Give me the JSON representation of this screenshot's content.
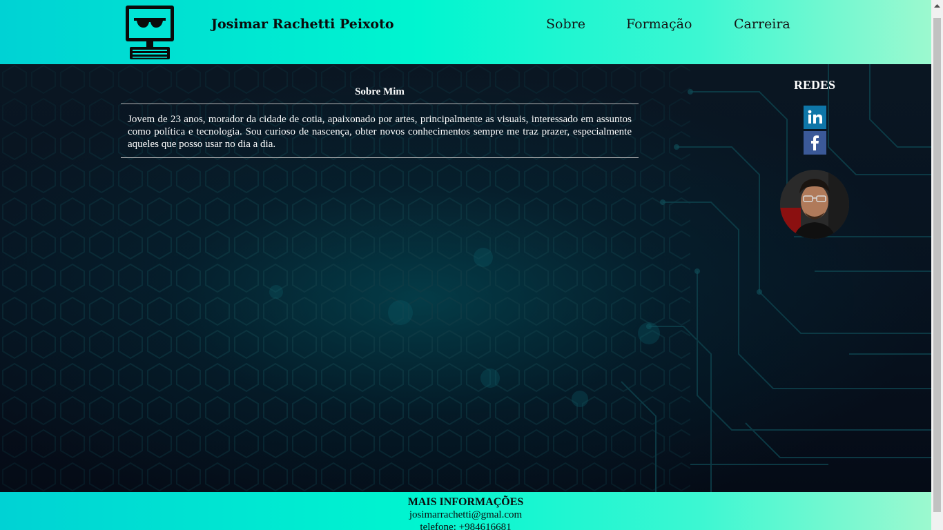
{
  "header": {
    "site_title": "Josimar Rachetti Peixoto",
    "nav": [
      {
        "label": "Sobre"
      },
      {
        "label": "Formação"
      },
      {
        "label": "Carreira"
      }
    ],
    "logo_icon": "computer-sunglasses-icon"
  },
  "about": {
    "title": "Sobre Mim",
    "text": "Jovem de 23 anos, morador da cidade de cotia, apaixonado por artes, principalmente as visuais, interessado em assuntos como política e tecnologia. Sou curioso de nascença, obter novos conhecimentos sempre me traz prazer, especialmente aqueles que posso usar no dia a dia."
  },
  "sidebar": {
    "title": "REDES",
    "social": [
      {
        "icon": "linkedin-icon",
        "color": "#0e76a8"
      },
      {
        "icon": "facebook-icon",
        "color": "#3b5998"
      }
    ],
    "avatar_icon": "profile-photo"
  },
  "footer": {
    "title": "MAIS INFORMAÇÕES",
    "email": "josimarrachetti@gmal.com",
    "phone": "telefone: +984616681"
  },
  "colors": {
    "header_gradient_start": "#00d2d4",
    "header_gradient_end": "#9cf9cf",
    "main_bg": "#06080f",
    "text_light": "#ffffff"
  }
}
